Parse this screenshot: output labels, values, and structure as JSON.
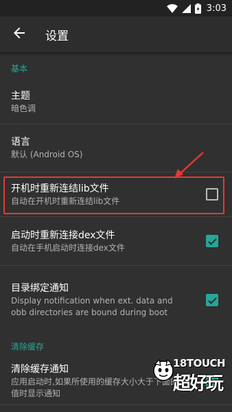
{
  "status_bar": {
    "time": "3:03"
  },
  "app_bar": {
    "title": "设置"
  },
  "sections": {
    "basic": {
      "header": "基本",
      "theme": {
        "title": "主题",
        "summary": "暗色调"
      },
      "language": {
        "title": "语言",
        "summary": "默认 (Android OS)"
      },
      "boot_lib": {
        "title": "开机时重新连结lib文件",
        "summary": "自动在开机时重新连结lib文件",
        "checked": false
      },
      "launch_dex": {
        "title": "启动时重新连接dex文件",
        "summary": "自动在手机启动时连接dex文件",
        "checked": true
      },
      "dir_notify": {
        "title": "目录绑定通知",
        "summary": "Display notification when ext. data and obb directories are bound during boot",
        "checked": true
      }
    },
    "cache": {
      "header": "清除缓存",
      "cache_notify": {
        "title": "清除缓存通知",
        "summary": "应用启动时,如果所使用的缓存大小大于下面的值时显示通知",
        "checked": true
      }
    }
  },
  "watermark": {
    "line1": "18TOUCH",
    "line2": "超好玩"
  },
  "colors": {
    "accent": "#26a69a",
    "highlight": "#e53935",
    "background": "#303030",
    "app_bar": "#2d2d2d"
  }
}
